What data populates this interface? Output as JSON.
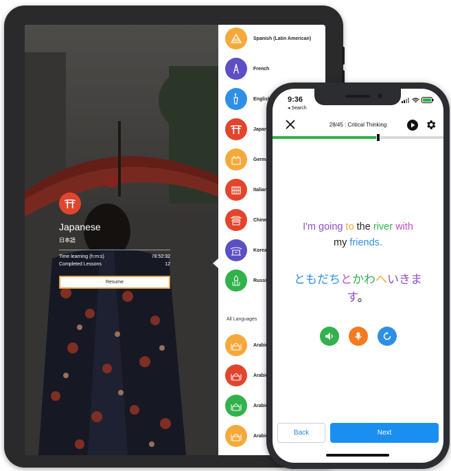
{
  "tablet": {
    "selected_language": {
      "name": "Japanese",
      "native": "日本語",
      "stats": [
        {
          "label": "Time learning (h:m:s)",
          "value": "78:52:32"
        },
        {
          "label": "Completed Lessons",
          "value": "12"
        }
      ],
      "resume_label": "Resume"
    },
    "languages": [
      {
        "name": "Spanish (Latin American)",
        "color": "#f6a93b",
        "icon": "pyramid-icon"
      },
      {
        "name": "French",
        "color": "#5b4fc4",
        "icon": "eiffel-tower-icon"
      },
      {
        "name": "English",
        "color": "#2f8fe6",
        "icon": "statue-of-liberty-icon"
      },
      {
        "name": "Japanese",
        "color": "#e2452d",
        "icon": "torii-gate-icon"
      },
      {
        "name": "German",
        "color": "#f6a93b",
        "icon": "castle-icon"
      },
      {
        "name": "Italian",
        "color": "#e2452d",
        "icon": "colosseum-icon"
      },
      {
        "name": "Chinese",
        "color": "#e2452d",
        "icon": "pagoda-icon"
      },
      {
        "name": "Korean",
        "color": "#5b4fc4",
        "icon": "korean-temple-icon"
      },
      {
        "name": "Russian",
        "color": "#31b24b",
        "icon": "onion-dome-icon"
      }
    ],
    "all_languages_label": "All Languages",
    "all_languages": [
      {
        "name": "Arabic",
        "color": "#f6a93b",
        "icon": "mosque-icon"
      },
      {
        "name": "Arabic",
        "color": "#e2452d",
        "icon": "mosque-icon"
      },
      {
        "name": "Arabic",
        "color": "#31b24b",
        "icon": "mosque-icon"
      },
      {
        "name": "Arabic",
        "color": "#f6a93b",
        "icon": "mosque-icon"
      }
    ]
  },
  "phone": {
    "status": {
      "time": "9:36",
      "back_label": "◂ Search"
    },
    "lesson_title": "28/45 : Critical Thinking",
    "progress": 0.62,
    "sentence_en": [
      {
        "text": "I'm going",
        "color": "#8e4fc6"
      },
      {
        "text": "to",
        "color": "#f6a93b"
      },
      {
        "text": "the",
        "color": "#222222"
      },
      {
        "text": "river",
        "color": "#31b24b"
      },
      {
        "text": "with",
        "color": "#c34fc6"
      },
      {
        "text": "my",
        "color": "#222222"
      },
      {
        "text": "friends.",
        "color": "#2f8fe6"
      }
    ],
    "sentence_jp": [
      {
        "text": "ともだち",
        "color": "#2f8fe6"
      },
      {
        "text": "と",
        "color": "#c34fc6"
      },
      {
        "text": "かわ",
        "color": "#31b24b"
      },
      {
        "text": "へ",
        "color": "#f6a93b"
      },
      {
        "text": "いきま",
        "color": "#8e4fc6"
      },
      {
        "text": "す",
        "color": "#8e4fc6"
      },
      {
        "text": "。",
        "color": "#222222"
      }
    ],
    "controls": [
      {
        "name": "speaker-icon",
        "color": "#31b24b"
      },
      {
        "name": "microphone-icon",
        "color": "#f47b20"
      },
      {
        "name": "replay-icon",
        "color": "#2f8fe6"
      }
    ],
    "back_label": "Back",
    "next_label": "Next"
  }
}
